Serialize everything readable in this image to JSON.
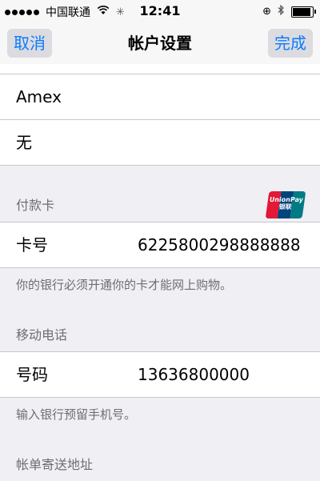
{
  "status_bar": {
    "carrier": "中国联通",
    "time": "12:41",
    "battery_level": 0.9
  },
  "nav": {
    "left_button": "取消",
    "title": "帐户设置",
    "right_button": "完成"
  },
  "rows_top": [
    {
      "text": "Amex"
    },
    {
      "text": "无"
    }
  ],
  "payment_section": {
    "header": "付款卡",
    "logo_text": "UnionPay 银联",
    "card_label": "卡号",
    "card_number": "6225800298888888",
    "note": "你的银行必须开通你的卡才能网上购物。"
  },
  "phone_section": {
    "header": "移动电话",
    "label": "号码",
    "number": "13636800000",
    "note": "输入银行预留手机号。"
  },
  "billing_section": {
    "header": "帐单寄送地址"
  }
}
